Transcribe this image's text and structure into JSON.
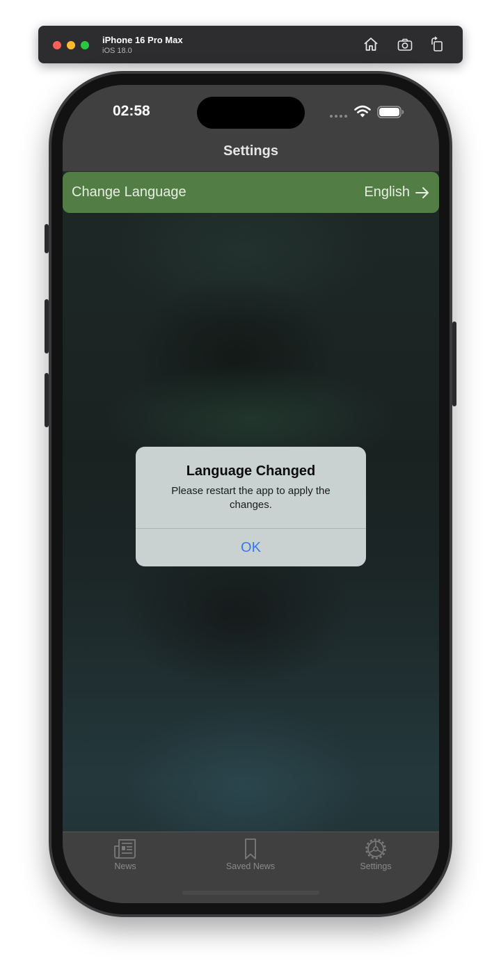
{
  "simulator": {
    "device_name": "iPhone 16 Pro Max",
    "os_version": "iOS 18.0",
    "buttons": [
      "home-icon",
      "screenshot-icon",
      "rotate-icon"
    ]
  },
  "status_bar": {
    "time": "02:58"
  },
  "nav": {
    "title": "Settings"
  },
  "settings": {
    "language_label": "Change Language",
    "language_value": "English",
    "row_color": "#527e45"
  },
  "alert": {
    "title": "Language Changed",
    "message": "Please restart the app to apply the changes.",
    "ok_label": "OK",
    "ok_color": "#3478f6"
  },
  "tabbar": {
    "items": [
      {
        "label": "News",
        "icon": "newspaper-icon"
      },
      {
        "label": "Saved News",
        "icon": "bookmark-icon"
      },
      {
        "label": "Settings",
        "icon": "gear-icon"
      }
    ]
  }
}
